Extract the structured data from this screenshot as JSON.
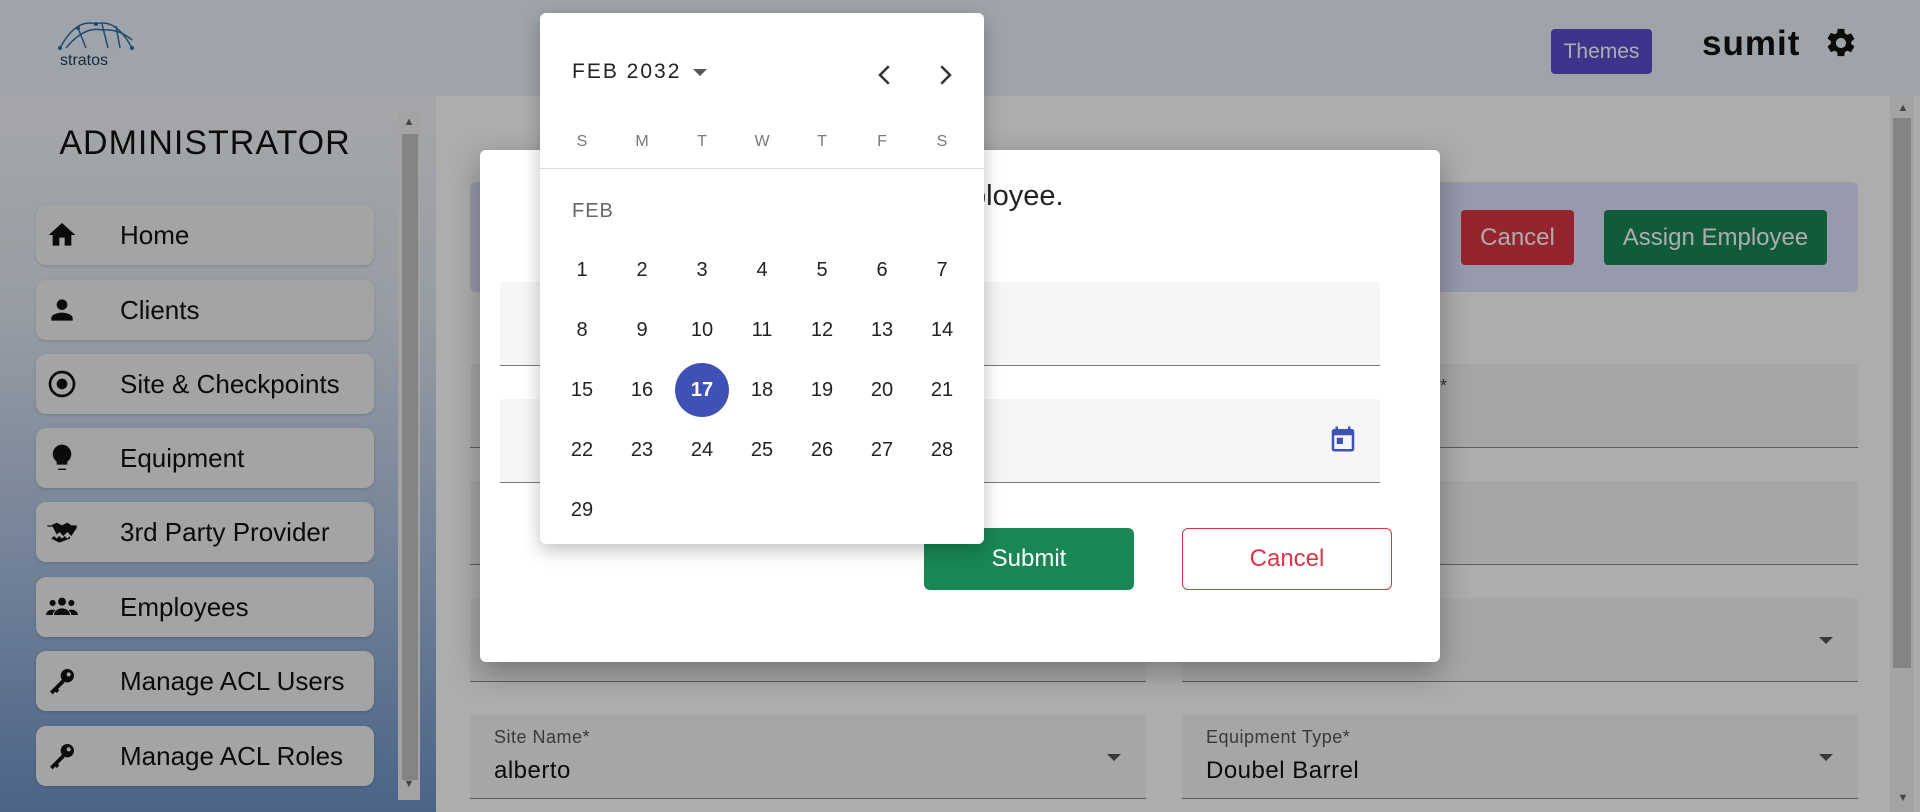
{
  "header": {
    "logo_text": "stratos",
    "themes_label": "Themes",
    "user_name": "sumit",
    "settings_icon": "gear-icon"
  },
  "sidebar": {
    "title": "ADMINISTRATOR",
    "items": [
      {
        "label": "Home",
        "icon": "home-icon"
      },
      {
        "label": "Clients",
        "icon": "person-icon"
      },
      {
        "label": "Site & Checkpoints",
        "icon": "radio-target-icon"
      },
      {
        "label": "Equipment",
        "icon": "lightbulb-icon"
      },
      {
        "label": "3rd Party Provider",
        "icon": "handshake-icon"
      },
      {
        "label": "Employees",
        "icon": "group-icon"
      },
      {
        "label": "Manage ACL Users",
        "icon": "key-icon"
      },
      {
        "label": "Manage ACL Roles",
        "icon": "key-icon"
      }
    ]
  },
  "banner": {
    "cancel_label": "Cancel",
    "assign_label": "Assign Employee"
  },
  "form": {
    "site_name_label": "Site Name*",
    "site_name_value": "alberto",
    "equipment_type_label": "Equipment Type*",
    "equipment_type_value": "Doubel Barrel",
    "partial_label_star": "*"
  },
  "dialog": {
    "title_visible": "ployee.",
    "submit_label": "Submit",
    "cancel_label": "Cancel",
    "calendar_icon": "calendar-icon"
  },
  "datepicker": {
    "month_year": "FEB 2032",
    "month_label": "FEB",
    "weekdays": [
      "S",
      "M",
      "T",
      "W",
      "T",
      "F",
      "S"
    ],
    "selected_day": "17",
    "days": [
      "1",
      "2",
      "3",
      "4",
      "5",
      "6",
      "7",
      "8",
      "9",
      "10",
      "11",
      "12",
      "13",
      "14",
      "15",
      "16",
      "17",
      "18",
      "19",
      "20",
      "21",
      "22",
      "23",
      "24",
      "25",
      "26",
      "27",
      "28",
      "29"
    ]
  },
  "colors": {
    "accent": "#3f51b5",
    "success": "#198754",
    "danger": "#dc3545",
    "themes": "#5a4fcf"
  }
}
